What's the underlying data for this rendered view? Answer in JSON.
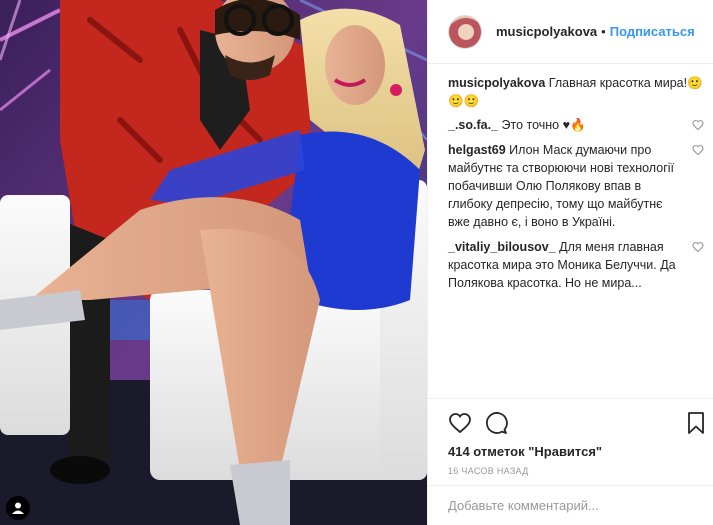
{
  "post": {
    "author": "musicpolyakova",
    "follow_label": "Подписаться",
    "separator": "•",
    "caption": "Главная красотка мира!🙂🙂🙂"
  },
  "comments": [
    {
      "user": "_.so.fa._",
      "text": "Это точно ♥🔥"
    },
    {
      "user": "helgast69",
      "text": "Илон Маск думаючи про майбутнє та створюючи нові технології побачивши Олю Полякову впав в глибоку депресію, тому що майбутнє вже давно є, і воно в Україні."
    },
    {
      "user": "_vitaliy_bilousov_",
      "text": "Для меня главная красотка мира это Моника Белуччи. Да Полякова красотка. Но не мира..."
    }
  ],
  "stats": {
    "likes": "414 отметок \"Нравится\"",
    "time": "16 часов назад"
  },
  "add_comment": {
    "placeholder": "Добавьте комментарий..."
  },
  "icons": {
    "like": "heart-icon",
    "comment": "comment-icon",
    "share": "share-icon",
    "save": "bookmark-icon",
    "tagged": "person-tag-icon"
  },
  "colors": {
    "accent": "#3897f0",
    "text": "#262626",
    "muted": "#999999",
    "border": "#efefef"
  }
}
